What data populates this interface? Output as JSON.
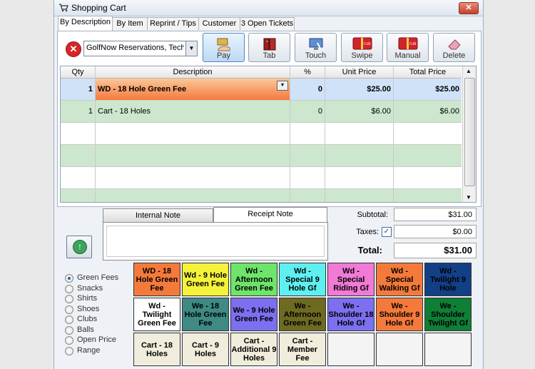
{
  "window": {
    "title": "Shopping Cart",
    "close_label": "✕"
  },
  "tabs": [
    {
      "label": "By Description"
    },
    {
      "label": "By Item"
    },
    {
      "label": "Reprint / Tips"
    },
    {
      "label": "Customer"
    },
    {
      "label": "3 Open Tickets"
    }
  ],
  "customer_select": {
    "value": "GolfNow Reservations, Tech S"
  },
  "toolbar": [
    {
      "label": "Pay",
      "icon": "pay-hand-icon"
    },
    {
      "label": "Tab",
      "icon": "tab-book-icon"
    },
    {
      "label": "Touch",
      "icon": "touch-screen-icon"
    },
    {
      "label": "Swipe",
      "icon": "gift-card-icon"
    },
    {
      "label": "Manual",
      "icon": "gift-card-icon"
    },
    {
      "label": "Delete",
      "icon": "eraser-icon"
    }
  ],
  "grid": {
    "headers": [
      "Qty",
      "Description",
      "%",
      "Unit Price",
      "Total Price"
    ],
    "rows": [
      {
        "qty": "1",
        "description": "WD - 18 Hole Green Fee",
        "pct": "0",
        "unit": "$25.00",
        "total": "$25.00",
        "selected": true
      },
      {
        "qty": "1",
        "description": "Cart - 18 Holes",
        "pct": "0",
        "unit": "$6.00",
        "total": "$6.00",
        "selected": false
      }
    ]
  },
  "notes": {
    "internal_label": "Internal Note",
    "receipt_label": "Receipt Note"
  },
  "totals": {
    "subtotal_label": "Subtotal:",
    "subtotal": "$31.00",
    "taxes_label": "Taxes:",
    "taxes": "$0.00",
    "taxes_checked": "✓",
    "total_label": "Total:",
    "total": "$31.00"
  },
  "categories": [
    {
      "label": "Green Fees",
      "selected": true
    },
    {
      "label": "Snacks"
    },
    {
      "label": "Shirts"
    },
    {
      "label": "Shoes"
    },
    {
      "label": "Clubs"
    },
    {
      "label": "Balls"
    },
    {
      "label": "Open Price"
    },
    {
      "label": "Range"
    }
  ],
  "items": [
    {
      "label": "WD - 18 Hole Green Fee",
      "bg": "#f47a3c",
      "fg": "#000000"
    },
    {
      "label": "Wd - 9 Hole Green Fee",
      "bg": "#f5f23a",
      "fg": "#000000"
    },
    {
      "label": "Wd - Afternoon Green Fee",
      "bg": "#6ee56a",
      "fg": "#000000"
    },
    {
      "label": "Wd - Special 9 Hole Gf",
      "bg": "#5ef0f0",
      "fg": "#000000"
    },
    {
      "label": "Wd - Special Riding Gf",
      "bg": "#f07ad6",
      "fg": "#000000"
    },
    {
      "label": "Wd - Special Walking Gf",
      "bg": "#f47a3c",
      "fg": "#000000"
    },
    {
      "label": "Wd - Twilight 9 Hole",
      "bg": "#123f86",
      "fg": "#000000"
    },
    {
      "label": "Wd - Twilight Green Fee",
      "bg": "#ffffff",
      "fg": "#000000"
    },
    {
      "label": "We - 18 Hole Green Fee",
      "bg": "#3f8a84",
      "fg": "#000000"
    },
    {
      "label": "We - 9 Hole Green Fee",
      "bg": "#7c6ff0",
      "fg": "#000000"
    },
    {
      "label": "We - Afternoon Green Fee",
      "bg": "#6e6a22",
      "fg": "#000000"
    },
    {
      "label": "We - Shoulder 18 Hole Gf",
      "bg": "#7c6ff0",
      "fg": "#000000"
    },
    {
      "label": "We - Shoulder 9 Hole Gf",
      "bg": "#f47a3c",
      "fg": "#000000"
    },
    {
      "label": "We - Shoulder Twilight Gf",
      "bg": "#0f7f36",
      "fg": "#000000"
    },
    {
      "label": "Cart - 18 Holes",
      "bg": "#f1eddc",
      "fg": "#000000"
    },
    {
      "label": "Cart - 9 Holes",
      "bg": "#f1eddc",
      "fg": "#000000"
    },
    {
      "label": "Cart - Additional 9 Holes",
      "bg": "#f1eddc",
      "fg": "#000000"
    },
    {
      "label": "Cart - Member Fee",
      "bg": "#f1eddc",
      "fg": "#000000"
    },
    {
      "label": "",
      "bg": "#f4f4f4",
      "fg": "#000000"
    },
    {
      "label": "",
      "bg": "#f4f4f4",
      "fg": "#000000"
    },
    {
      "label": "",
      "bg": "#f4f4f4",
      "fg": "#000000"
    }
  ]
}
